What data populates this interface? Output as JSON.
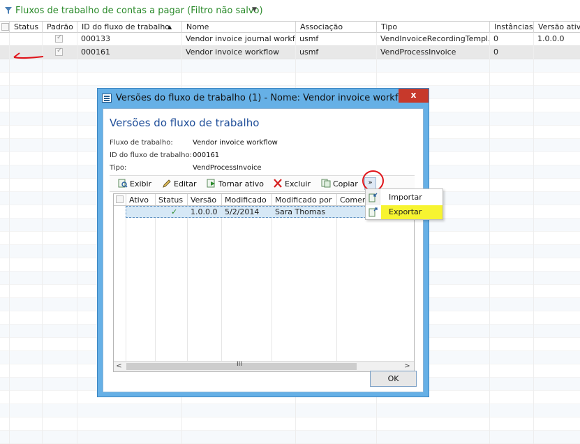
{
  "page": {
    "title": "Fluxos de trabalho de contas a pagar (Filtro não salvo)",
    "columns": [
      "Status",
      "Padrão",
      "ID do fluxo de trabalho",
      "Nome",
      "Associação",
      "Tipo",
      "Instâncias",
      "Versão ativa"
    ],
    "sort_indicator": "▲",
    "rows": [
      {
        "padrao": true,
        "id": "000133",
        "nome": "Vendor invoice journal workfl...",
        "associacao": "usmf",
        "tipo": "VendInvoiceRecordingTempl...",
        "instancias": "0",
        "versao": "1.0.0.0"
      },
      {
        "padrao": true,
        "id": "000161",
        "nome": "Vendor invoice workflow",
        "associacao": "usmf",
        "tipo": "VendProcessInvoice",
        "instancias": "0",
        "versao": ""
      }
    ]
  },
  "dialog": {
    "title": "Versões do fluxo de trabalho (1) - Nome: Vendor invoice workflo...",
    "close_label": "x",
    "heading": "Versões do fluxo de trabalho",
    "fields": [
      {
        "label": "Fluxo de trabalho:",
        "value": "Vendor invoice workflow"
      },
      {
        "label": "ID do fluxo de trabalho:",
        "value": "000161"
      },
      {
        "label": "Tipo:",
        "value": "VendProcessInvoice"
      }
    ],
    "toolbar": {
      "exibir": "Exibir",
      "editar": "Editar",
      "tornar_ativo": "Tornar ativo",
      "excluir": "Excluir",
      "copiar": "Copiar",
      "overflow": "»"
    },
    "grid": {
      "columns": [
        "Ativo",
        "Status",
        "Versão",
        "Modificado",
        "Modificado por",
        "Comenta"
      ],
      "rows": [
        {
          "ativo": "",
          "status": "✓",
          "versao": "1.0.0.0",
          "modificado": "5/2/2014",
          "modificado_por": "Sara Thomas",
          "comentario": ""
        }
      ],
      "scroll_grip": "III",
      "scroll_left": "<",
      "scroll_right": ">"
    },
    "ok_label": "OK"
  },
  "menu": {
    "items": [
      {
        "label": "Importar",
        "highlighted": false
      },
      {
        "label": "Exportar",
        "highlighted": true
      }
    ]
  },
  "colors": {
    "title_green": "#2a8a2a",
    "dialog_frame": "#66b0e6",
    "heading_blue": "#1f4e99",
    "close_red": "#c7392b",
    "highlight_yellow": "#f7f431",
    "annotation_red": "#e0141a"
  }
}
